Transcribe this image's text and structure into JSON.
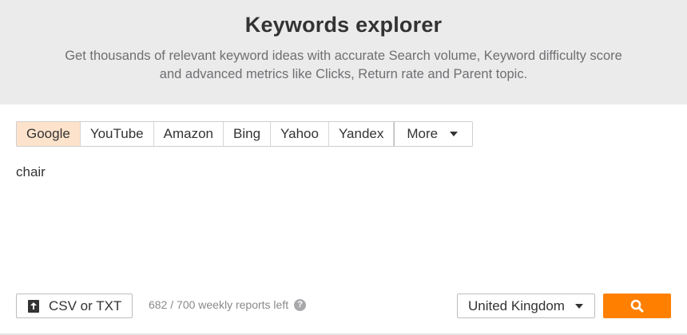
{
  "hero": {
    "title": "Keywords explorer",
    "subtitle": "Get thousands of relevant keyword ideas with accurate Search volume, Keyword difficulty score and advanced metrics like Clicks, Return rate and Parent topic."
  },
  "tabs": [
    {
      "label": "Google",
      "active": true
    },
    {
      "label": "YouTube",
      "active": false
    },
    {
      "label": "Amazon",
      "active": false
    },
    {
      "label": "Bing",
      "active": false
    },
    {
      "label": "Yahoo",
      "active": false
    },
    {
      "label": "Yandex",
      "active": false
    }
  ],
  "more_tab": {
    "label": "More",
    "icon": "chevron-down-icon"
  },
  "keyword_input": {
    "value": "chair"
  },
  "upload": {
    "label": "CSV or TXT",
    "icon": "upload-icon"
  },
  "reports": {
    "text": "682 / 700 weekly reports left",
    "help_icon": "?"
  },
  "country": {
    "selected": "United Kingdom"
  },
  "search_button": {
    "icon": "search-icon"
  },
  "colors": {
    "accent": "#ff8000",
    "active_tab_bg": "#fde3cb",
    "hero_bg": "#ebebec"
  }
}
